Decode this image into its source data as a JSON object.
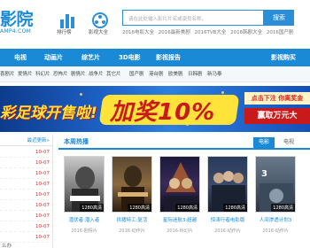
{
  "header": {
    "logo": "影院",
    "logo_sub": "AMP4.COM",
    "icons": [
      {
        "label": "排行榜",
        "icon": "bar-chart-icon"
      },
      {
        "label": "影视大全",
        "icon": "film-reel-icon"
      }
    ],
    "search": {
      "placeholder": "请在此处输入影片片名或演员名称。",
      "button": "搜索"
    },
    "hot_links": [
      "2016电影大全",
      "2016最新美剧",
      "2016TVB大全",
      "2016韩剧大全",
      "2016国产剧"
    ]
  },
  "nav": {
    "items": [
      "电视",
      "动画片",
      "综艺片",
      "3D电影",
      "影视报告"
    ],
    "right": "影视购买"
  },
  "subnav": {
    "items": [
      "喜剧片",
      "爱情片",
      "科幻片",
      "恐怖片",
      "剧情片",
      "战争片",
      "其它片",
      "国产剧",
      "港台剧",
      "欧美剧",
      "日韩剧",
      "新马泰"
    ]
  },
  "banner": {
    "title": "彩足球开售啦!",
    "bonus": "加奖10%",
    "cta_top": "点击下注 你离奖金",
    "cta_bottom": "赢取万元大"
  },
  "left_list": {
    "head": "最近更新»",
    "dates": [
      "10-07",
      "10-07",
      "10-07",
      "10-07",
      "10-07",
      "10-07",
      "10-07",
      "10-07",
      "10-07"
    ],
    "footer": "么办"
  },
  "main": {
    "title": "本周热播",
    "tabs": [
      {
        "label": "电影",
        "active": true
      },
      {
        "label": "电视",
        "active": false
      }
    ],
    "posters": [
      {
        "name": "潜伏者:潜入者",
        "meta": "2016-剧情片",
        "badge": "1280高清"
      },
      {
        "name": "拱猪特工:复活",
        "meta": "2016-动作片",
        "badge": "1280高清"
      },
      {
        "name": "星际迷航3:超越",
        "meta": "2016-科幻片",
        "badge": "1280高清"
      },
      {
        "name": "惊涛行者电影版",
        "meta": "2016-动作片",
        "badge": "1280高清"
      },
      {
        "name": "人间渗透计划3",
        "meta": "2016-动作片",
        "badge": "1280高清"
      }
    ]
  },
  "colors": {
    "brand": "#1a8ad6",
    "accent_red": "#e02a2a",
    "banner_yellow": "#ffe23a"
  }
}
